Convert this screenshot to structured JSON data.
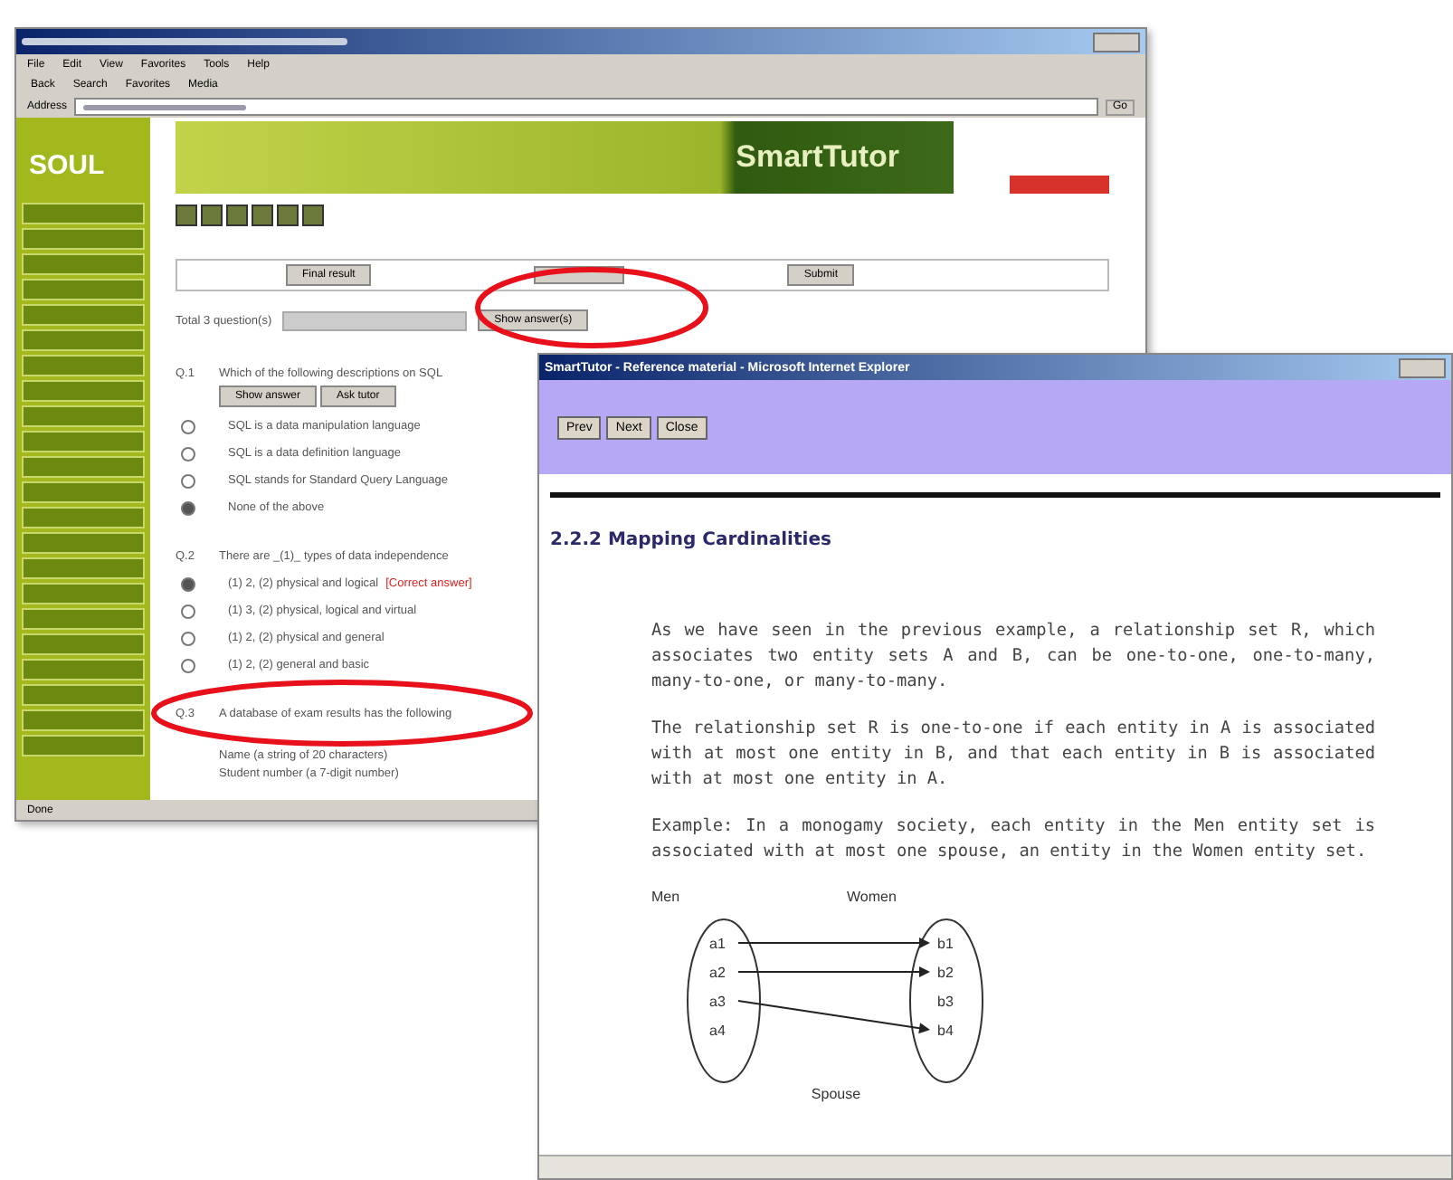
{
  "browser_window": {
    "menu": [
      "File",
      "Edit",
      "View",
      "Favorites",
      "Tools",
      "Help"
    ],
    "toolbar": [
      "Back",
      "Search",
      "Favorites",
      "Media"
    ],
    "address_label": "Address",
    "go": "Go",
    "logo": "SOUL",
    "banner": "SmartTutor",
    "result_buttons": [
      "Final result",
      "Submit"
    ],
    "total": "Total 3 question(s)",
    "show_answers": "Show answer(s)",
    "questions": [
      {
        "number": "Q.1",
        "text": "Which of the following descriptions on SQL",
        "buttons": [
          "Show answer",
          "Ask tutor"
        ],
        "options": [
          {
            "text": "SQL is a data manipulation language",
            "selected": false
          },
          {
            "text": "SQL is a data definition language",
            "selected": false
          },
          {
            "text": "SQL stands for Standard Query Language",
            "selected": false
          },
          {
            "text": "None of the above",
            "selected": true
          }
        ]
      },
      {
        "number": "Q.2",
        "text": "There are _(1)_ types of data independence",
        "options": [
          {
            "text": "(1) 2, (2) physical and logical",
            "note": "[Correct answer]",
            "selected": true
          },
          {
            "text": "(1) 3, (2) physical, logical and virtual",
            "selected": false
          },
          {
            "text": "(1) 2, (2) physical and general",
            "selected": false
          },
          {
            "text": "(1) 2, (2) general and basic",
            "selected": false
          }
        ]
      },
      {
        "number": "Q.3",
        "text": "A database of exam results has the following",
        "lines": [
          "Name (a string of 20 characters)",
          "Student number (a 7-digit number)"
        ]
      }
    ],
    "status": "Done"
  },
  "reference_window": {
    "title": "SmartTutor - Reference material - Microsoft Internet Explorer",
    "buttons": [
      "Prev",
      "Next",
      "Close"
    ],
    "heading": "2.2.2 Mapping Cardinalities",
    "paragraphs": [
      "As we have seen in the previous example, a relationship set R, which associates two entity sets A and B, can be one-to-one, one-to-many, many-to-one, or many-to-many.",
      "The relationship set R is one-to-one if each entity in A is associated with at most one entity in B, and that each entity in B is associated with at most one entity in A.",
      "Example: In a monogamy society, each entity in the Men entity set is associated with at most one spouse, an entity in the Women entity set."
    ],
    "diagram": {
      "left_label": "Men",
      "right_label": "Women",
      "left": [
        {
          "label": "a1",
          "arrow": true
        },
        {
          "label": "a2",
          "arrow": true
        },
        {
          "label": "a3",
          "arrow": true
        },
        {
          "label": "a4",
          "arrow": false
        }
      ],
      "right": [
        {
          "label": "b1",
          "arrow": true
        },
        {
          "label": "b2",
          "arrow": true
        },
        {
          "label": "b3",
          "arrow": false
        },
        {
          "label": "b4",
          "arrow": true
        }
      ],
      "caption": "Spouse"
    }
  },
  "annotations": [
    {
      "kind": "ellipse"
    },
    {
      "kind": "ellipse"
    }
  ]
}
